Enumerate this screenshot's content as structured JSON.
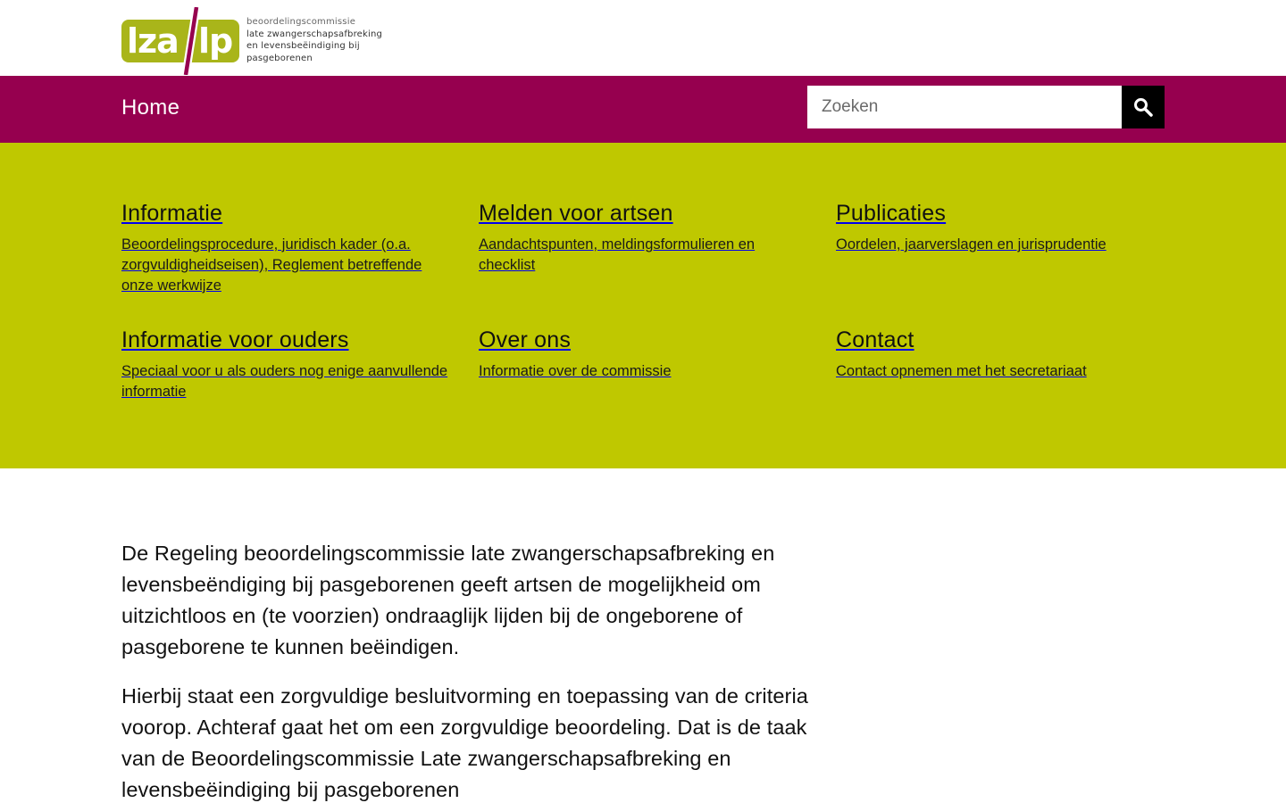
{
  "logo": {
    "mark_text": "lza/lp",
    "lines": [
      "beoordelingscommissie",
      "late zwangerschapsafbreking",
      "en levensbeëindiging bij",
      "pasgeborenen"
    ]
  },
  "nav": {
    "home_label": "Home"
  },
  "search": {
    "placeholder": "Zoeken",
    "value": ""
  },
  "menu": {
    "items": [
      {
        "title": "Informatie",
        "description": "Beoordelingsprocedure, juridisch kader (o.a. zorgvuldigheidseisen), Reglement betreffende onze werkwijze"
      },
      {
        "title": "Melden voor artsen",
        "description": "Aandachtspunten, meldingsformulieren en checklist"
      },
      {
        "title": "Publicaties",
        "description": "Oordelen, jaarverslagen en jurisprudentie"
      },
      {
        "title": "Informatie voor ouders",
        "description": "Speciaal voor u als ouders nog enige aanvullende informatie"
      },
      {
        "title": "Over ons",
        "description": "Informatie over de commissie"
      },
      {
        "title": "Contact",
        "description": "Contact opnemen met het secretariaat"
      }
    ]
  },
  "intro": {
    "paragraphs": [
      "De Regeling beoordelingscommissie late zwangerschapsafbreking en levensbeëndiging bij pasgeborenen geeft artsen de mogelijkheid om uitzichtloos en (te voorzien) ondraaglijk lijden bij de ongeborene of pasgeborene te kunnen beëindigen.",
      "Hierbij staat een zorgvuldige besluitvorming en toepassing van de criteria voorop. Achteraf gaat het om een zorgvuldige beoordeling. Dat is de taak van de Beoordelingscommissie Late zwangerschapsafbreking en levensbeëindiging bij pasgeborenen"
    ]
  },
  "colors": {
    "nav_background": "#96004f",
    "menu_background": "#bfc800",
    "search_button": "#000000",
    "logo_green": "#a9b51a",
    "logo_purple": "#96004f"
  },
  "icons": {
    "search_button": "search-icon"
  }
}
